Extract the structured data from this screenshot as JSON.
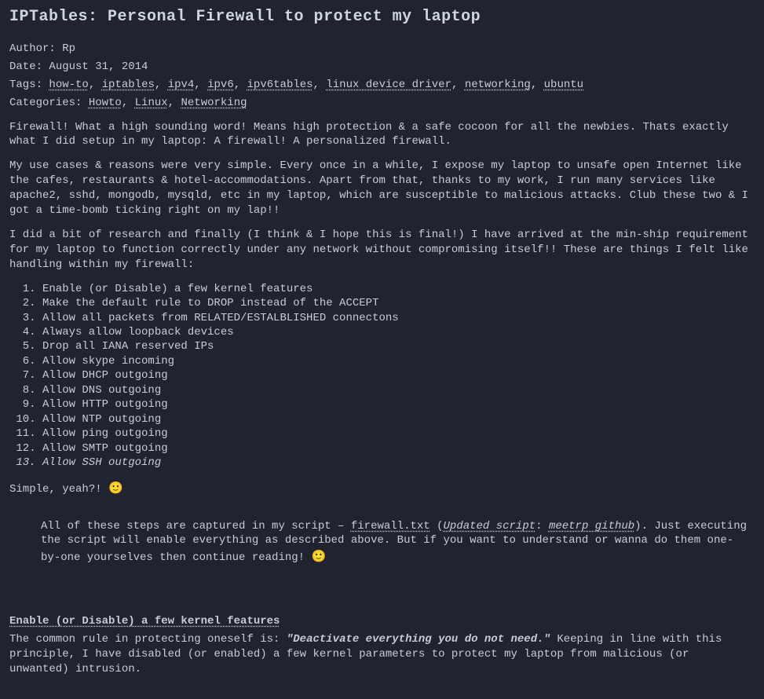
{
  "title": "IPTables: Personal Firewall to protect my laptop",
  "meta": {
    "author_label": "Author: ",
    "author": "Rp",
    "date_label": "Date: ",
    "date": "August 31, 2014",
    "tags_label": "Tags: ",
    "tags": [
      "how-to",
      "iptables",
      "ipv4",
      "ipv6",
      "ipv6tables",
      "linux device driver",
      "networking",
      "ubuntu"
    ],
    "categories_label": "Categories: ",
    "categories": [
      "Howto",
      "Linux",
      "Networking"
    ]
  },
  "paragraphs": {
    "p1": "Firewall! What a high sounding word! Means high protection & a safe cocoon for all the newbies. Thats exactly what I did setup in my laptop: A firewall! A personalized firewall.",
    "p2": "My use cases & reasons were very simple. Every once in a while, I expose my laptop to unsafe open Internet like the cafes, restaurants & hotel-accommodations. Apart from that, thanks to my work, I run many services like apache2, sshd, mongodb, mysqld, etc in my laptop, which are susceptible to malicious attacks. Club these two & I got a time-bomb ticking right on my lap!!",
    "p3": "I did a bit of research and finally (I think & I hope this is final!) I have arrived at the min-ship requirement for my laptop to function correctly under any network without compromising itself!! These are things I felt like handling within my firewall:"
  },
  "rules": [
    {
      "text": "Enable (or Disable) a few kernel features",
      "italic": false
    },
    {
      "text": "Make the default rule to DROP instead of the ACCEPT",
      "italic": false
    },
    {
      "text": "Allow all packets from RELATED/ESTALBLISHED connectons",
      "italic": false
    },
    {
      "text": "Always allow loopback devices",
      "italic": false
    },
    {
      "text": "Drop all IANA reserved IPs",
      "italic": false
    },
    {
      "text": "Allow skype incoming",
      "italic": false
    },
    {
      "text": "Allow DHCP outgoing",
      "italic": false
    },
    {
      "text": "Allow DNS outgoing",
      "italic": false
    },
    {
      "text": "Allow HTTP outgoing",
      "italic": false
    },
    {
      "text": "Allow NTP outgoing",
      "italic": false
    },
    {
      "text": "Allow ping outgoing",
      "italic": false
    },
    {
      "text": "Allow SMTP outgoing",
      "italic": false
    },
    {
      "text": "Allow SSH outgoing",
      "italic": true
    }
  ],
  "simple": {
    "text": "Simple, yeah?! ",
    "emoji": "🙂"
  },
  "callout": {
    "pre": "All of these steps are captured in my script – ",
    "link1": "firewall.txt",
    "mid1": " (",
    "link2": "Updated script",
    "mid2": ": ",
    "link3": "meetrp github",
    "post": "). Just executing the script will enable everything as described above. But if you want to understand or wanna do them one-by-one yourselves then continue reading! ",
    "emoji": "🙂"
  },
  "section": {
    "heading": "Enable (or Disable) a few kernel features",
    "body_pre": "The common rule in protecting oneself is: ",
    "quote": "\"Deactivate everything you do not need.\"",
    "body_post": " Keeping in line with this principle, I have disabled (or enabled) a few kernel parameters to protect my laptop from malicious (or unwanted) intrusion."
  }
}
